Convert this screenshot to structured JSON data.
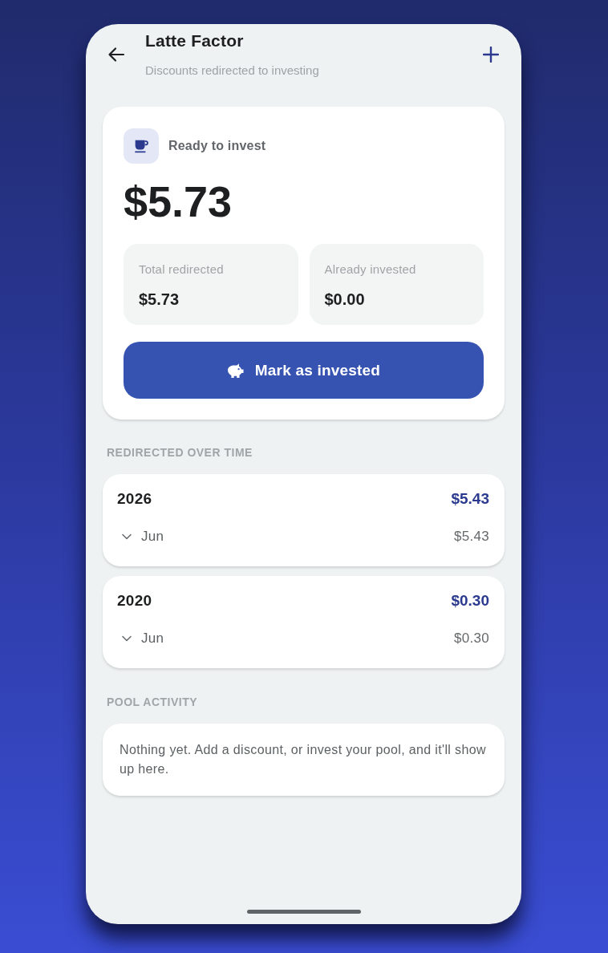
{
  "header": {
    "title": "Latte Factor",
    "subtitle": "Discounts redirected to investing"
  },
  "pool_card": {
    "label": "Ready to invest",
    "amount": "$5.73",
    "stats": [
      {
        "label": "Total redirected",
        "value": "$5.73"
      },
      {
        "label": "Already invested",
        "value": "$0.00"
      }
    ],
    "button": "Mark as invested"
  },
  "history": {
    "heading": "REDIRECTED OVER TIME",
    "years": [
      {
        "year": "2026",
        "total": "$5.43",
        "months": [
          {
            "month": "Jun",
            "amount": "$5.43",
            "expanded": false
          }
        ]
      },
      {
        "year": "2020",
        "total": "$0.30",
        "months": [
          {
            "month": "Jun",
            "amount": "$0.30",
            "expanded": false
          }
        ]
      }
    ]
  },
  "activity": {
    "heading": "POOL ACTIVITY",
    "message": "Nothing yet. Add a discount, or invest your pool, and it'll show up here."
  }
}
